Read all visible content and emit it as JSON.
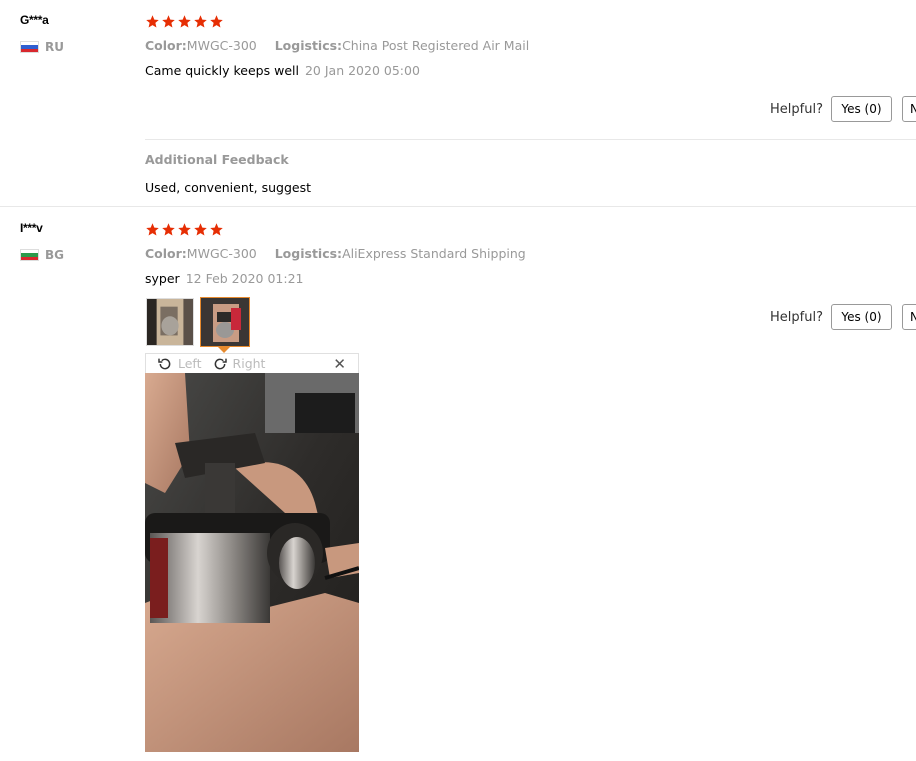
{
  "reviews": [
    {
      "user": "G***a",
      "country": "RU",
      "flag_colors": [
        "#ffffff",
        "#2f5fd0",
        "#d8282e"
      ],
      "rating": 5,
      "color_label": "Color:",
      "color_value": "MWGC-300",
      "logistics_label": "Logistics:",
      "logistics_value": "China Post Registered Air Mail",
      "comment": "Came quickly keeps well",
      "date": "20 Jan 2020 05:00",
      "helpful_label": "Helpful?",
      "yes_label": "Yes (0)",
      "no_label": "N",
      "additional_feedback_title": "Additional Feedback",
      "additional_feedback_text": "Used, convenient, suggest"
    },
    {
      "user": "I***v",
      "country": "BG",
      "flag_colors": [
        "#ffffff",
        "#2a9a4a",
        "#d8282e"
      ],
      "rating": 5,
      "color_label": "Color:",
      "color_value": "MWGC-300",
      "logistics_label": "Logistics:",
      "logistics_value": "AliExpress Standard Shipping",
      "comment": "syper",
      "date": "12 Feb 2020 01:21",
      "helpful_label": "Helpful?",
      "yes_label": "Yes (0)",
      "no_label": "N",
      "photos": [
        "review-photo-1",
        "review-photo-2"
      ],
      "viewer": {
        "rotate_left_label": "Left",
        "rotate_right_label": "Right",
        "close_icon": "close-icon"
      }
    }
  ],
  "colors": {
    "star": "#e62e04",
    "active_thumb_border": "#e68a2e",
    "muted_text": "#999999"
  }
}
